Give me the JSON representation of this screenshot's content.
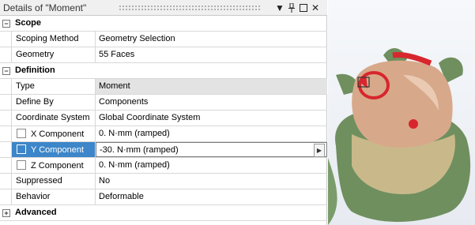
{
  "panel": {
    "title": "Details of \"Moment\"",
    "icons": {
      "dropdown": "chevron-down-icon",
      "pin": "pin-icon",
      "restore": "restore-icon",
      "close": "close-icon"
    }
  },
  "sections": {
    "scope": {
      "label": "Scope",
      "rows": [
        {
          "label": "Scoping Method",
          "value": "Geometry Selection"
        },
        {
          "label": "Geometry",
          "value": "55 Faces"
        }
      ]
    },
    "definition": {
      "label": "Definition",
      "rows": [
        {
          "label": "Type",
          "value": "Moment"
        },
        {
          "label": "Define By",
          "value": "Components"
        },
        {
          "label": "Coordinate System",
          "value": "Global Coordinate System"
        },
        {
          "label": "X Component",
          "value": "0. N·mm  (ramped)"
        },
        {
          "label": "Y Component",
          "value": "-30. N·mm  (ramped)"
        },
        {
          "label": "Z Component",
          "value": "0. N·mm  (ramped)"
        },
        {
          "label": "Suppressed",
          "value": "No"
        },
        {
          "label": "Behavior",
          "value": "Deformable"
        }
      ]
    },
    "advanced": {
      "label": "Advanced"
    }
  },
  "colors": {
    "selection": "#3c86c9",
    "moment_arrow": "#d8262e",
    "model_tan": "#d7a98a",
    "model_green": "#6f8f5f"
  }
}
